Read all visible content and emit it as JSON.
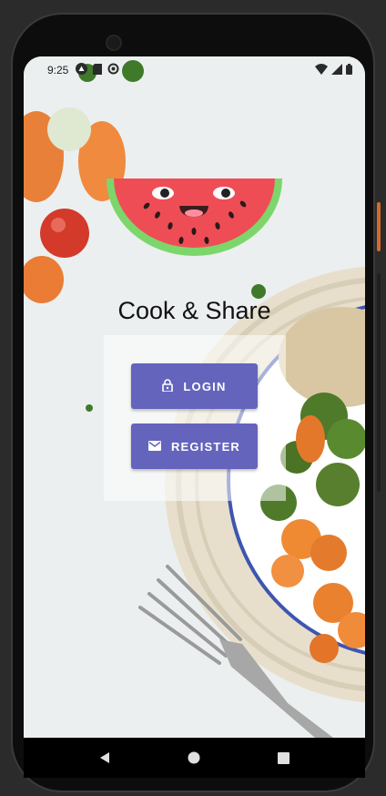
{
  "status_bar": {
    "time": "9:25",
    "icons_left": [
      "android-icon",
      "sd-card-icon",
      "sync-icon"
    ],
    "icons_right": [
      "wifi-icon",
      "signal-icon",
      "battery-icon"
    ]
  },
  "app": {
    "logo": "watermelon-logo",
    "title": "Cook & Share"
  },
  "buttons": {
    "login": {
      "label": "LOGIN",
      "icon": "lock-icon"
    },
    "register": {
      "label": "REGISTER",
      "icon": "mail-icon"
    }
  },
  "nav_bar": {
    "items": [
      "back-icon",
      "home-icon",
      "recents-icon"
    ]
  },
  "colors": {
    "accent": "#6464bd",
    "watermelon_rind": "#7dd66b",
    "watermelon_flesh": "#ef4d55"
  }
}
